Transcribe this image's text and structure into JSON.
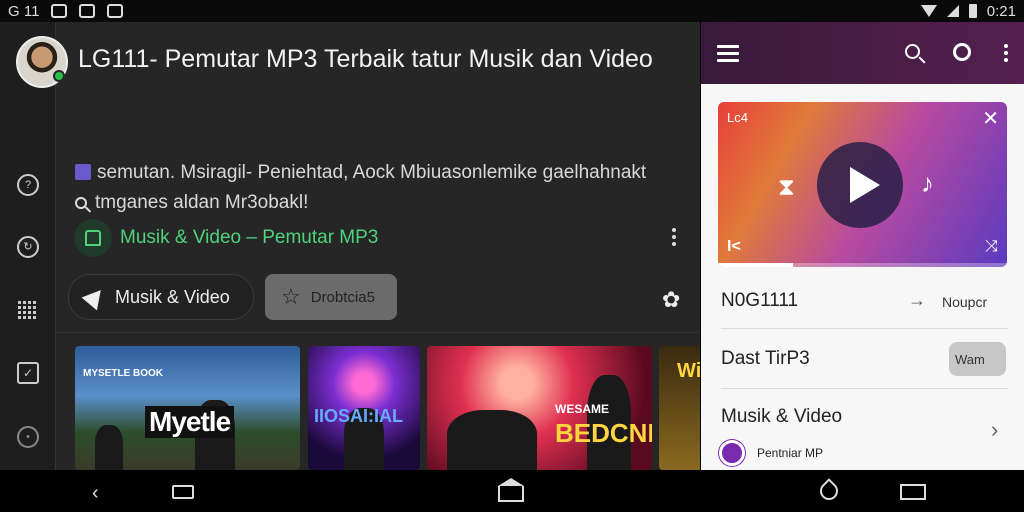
{
  "status_bar": {
    "left_text": "G 11",
    "time": "0:21"
  },
  "video": {
    "title": "LG111- Pemutar MP3 Terbaik tatur Musik dan Video",
    "description_line1": "semutan. Msiragil- Peniehtad, Aock Mbiuasonlemike gaelhahnakt",
    "description_line2": "tmganes aldan Mr3obakl!",
    "channel": "Musik & Video – Pemutar MP3"
  },
  "chips": [
    {
      "label": "Musik & Video",
      "icon": "send-icon"
    },
    {
      "label": "Drobtcia5",
      "icon": "star-icon"
    }
  ],
  "thumbnails": [
    {
      "label": "Myetle",
      "small": "MYSETLE BOOK"
    },
    {
      "label": "IIOSAI:IAL"
    },
    {
      "label": "BEDCNN",
      "small": "WESAME"
    },
    {
      "label": "Wi"
    }
  ],
  "panel": {
    "player": {
      "label": "Lc4",
      "progress": 0.26
    },
    "rows": [
      {
        "label": "N0G1111",
        "right": "Noupcr"
      },
      {
        "label": "Dast TirP3",
        "right": "Wam"
      },
      {
        "label": "Musik & Video"
      }
    ],
    "sub_label": "Pentniar MP"
  },
  "colors": {
    "accent_green": "#4fd37a",
    "header_purple": "#54204f",
    "background": "#262626"
  }
}
